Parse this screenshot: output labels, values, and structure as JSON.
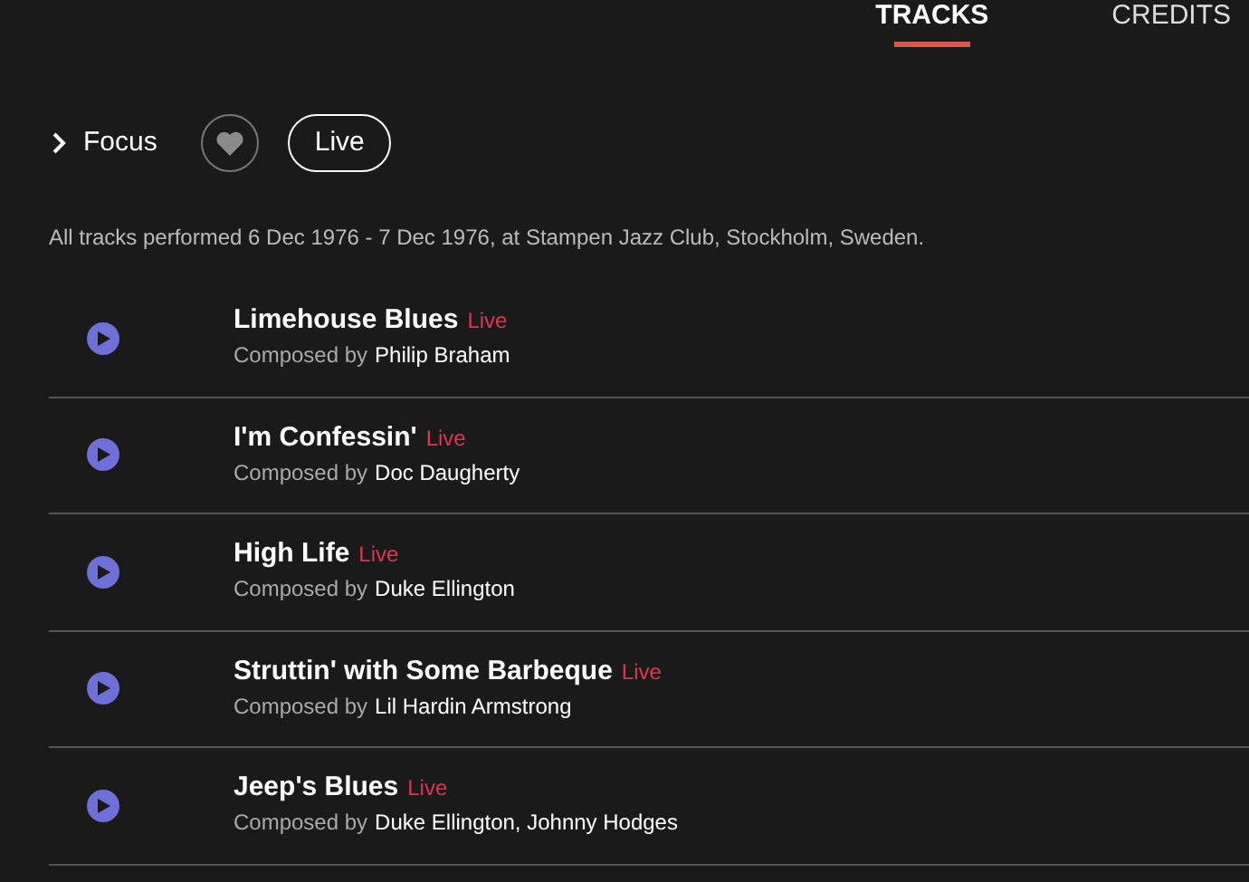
{
  "tabs": [
    {
      "label": "TRACKS",
      "selected": true
    },
    {
      "label": "CREDITS",
      "selected": false
    }
  ],
  "filters": {
    "focus": {
      "label": "Focus",
      "expanded": false
    },
    "favorite": {
      "on": false
    },
    "chip": {
      "label": "Live",
      "selected": true
    }
  },
  "note": "All tracks performed 6 Dec 1976 - 7 Dec 1976, at Stampen Jazz Club, Stockholm, Sweden.",
  "tracks": [
    {
      "title": "Limehouse Blues",
      "badge": "Live",
      "composed_label": "Composed by",
      "composers": "Philip Braham"
    },
    {
      "title": "I'm Confessin'",
      "badge": "Live",
      "composed_label": "Composed by",
      "composers": "Doc Daugherty"
    },
    {
      "title": "High Life",
      "badge": "Live",
      "composed_label": "Composed by",
      "composers": "Duke Ellington"
    },
    {
      "title": "Struttin' with Some Barbeque",
      "badge": "Live",
      "composed_label": "Composed by",
      "composers": "Lil Hardin Armstrong"
    },
    {
      "title": "Jeep's Blues",
      "badge": "Live",
      "composed_label": "Composed by",
      "composers": "Duke Ellington, Johnny Hodges"
    }
  ]
}
